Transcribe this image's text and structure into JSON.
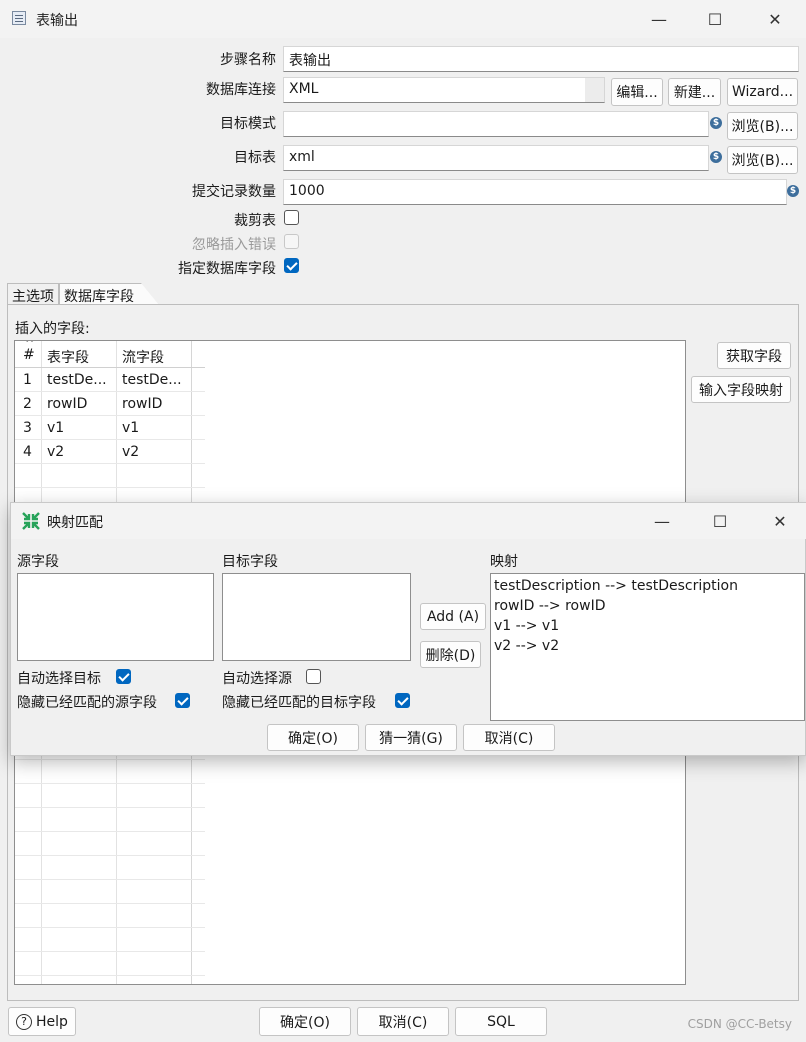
{
  "window": {
    "title": "表输出",
    "minimize": "—",
    "maximize": "☐",
    "close": "✕"
  },
  "form": {
    "step_name_label": "步骤名称",
    "step_name_value": "表输出",
    "db_conn_label": "数据库连接",
    "db_conn_value": "XML",
    "edit_button": "编辑...",
    "new_button": "新建...",
    "wizard_button": "Wizard...",
    "target_schema_label": "目标模式",
    "target_schema_value": "",
    "browse_schema_button": "浏览(B)...",
    "target_table_label": "目标表",
    "target_table_value": "xml",
    "browse_table_button": "浏览(B)...",
    "commit_size_label": "提交记录数量",
    "commit_size_value": "1000",
    "truncate_label": "裁剪表",
    "truncate_checked": false,
    "ignore_errors_label": "忽略插入错误",
    "ignore_errors_checked": false,
    "specify_fields_label": "指定数据库字段",
    "specify_fields_checked": true,
    "variable_icon_glyph": "$"
  },
  "tabs": [
    {
      "label": "主选项"
    },
    {
      "label": "数据库字段",
      "active": true
    }
  ],
  "fields_panel": {
    "insert_fields_label": "插入的字段:",
    "get_fields_button": "获取字段",
    "input_mapping_button": "输入字段映射",
    "columns": [
      "#",
      "表字段",
      "流字段"
    ],
    "sort_glyph": "^",
    "rows": [
      {
        "num": "1",
        "table_field": "testDe...",
        "stream_field": "testDe..."
      },
      {
        "num": "2",
        "table_field": "rowID",
        "stream_field": "rowID"
      },
      {
        "num": "3",
        "table_field": "v1",
        "stream_field": "v1"
      },
      {
        "num": "4",
        "table_field": "v2",
        "stream_field": "v2"
      }
    ]
  },
  "mapping_dialog": {
    "title": "映射匹配",
    "minimize": "—",
    "maximize": "☐",
    "close": "✕",
    "source_label": "源字段",
    "target_label": "目标字段",
    "mapping_label": "映射",
    "add_button": "Add (A)",
    "delete_button": "删除(D)",
    "auto_target_label": "自动选择目标",
    "auto_target_checked": true,
    "hide_source_label": "隐藏已经匹配的源字段",
    "hide_source_checked": true,
    "auto_source_label": "自动选择源",
    "auto_source_checked": false,
    "hide_target_label": "隐藏已经匹配的目标字段",
    "hide_target_checked": true,
    "mappings": [
      "testDescription --> testDescription",
      "rowID --> rowID",
      "v1 --> v1",
      "v2 --> v2"
    ],
    "ok_button": "确定(O)",
    "guess_button": "猜一猜(G)",
    "cancel_button": "取消(C)"
  },
  "footer": {
    "help_button": "Help",
    "ok_button": "确定(O)",
    "cancel_button": "取消(C)",
    "sql_button": "SQL",
    "watermark": "CSDN @CC-Betsy"
  }
}
